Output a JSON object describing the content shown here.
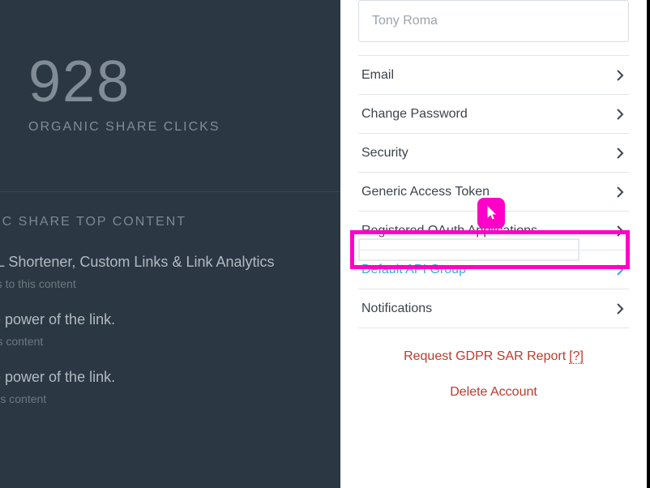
{
  "dark": {
    "stat_number": "928",
    "stat_label": "ORGANIC SHARE CLICKS",
    "section_title": "ANIC SHARE TOP CONTENT",
    "items": [
      {
        "title": "URL Shortener, Custom Links & Link Analytics",
        "sub": "Links to this content"
      },
      {
        "title": "The power of the link.",
        "sub": "o this content"
      },
      {
        "title": "The power of the link.",
        "sub": " to this content"
      }
    ]
  },
  "sidebar": {
    "name": "Tony Roma",
    "rows": [
      {
        "label": "Email"
      },
      {
        "label": "Change Password"
      },
      {
        "label": "Security"
      },
      {
        "label": "Generic Access Token"
      },
      {
        "label": "Registered OAuth Applications"
      },
      {
        "label": "Default API Group"
      },
      {
        "label": "Notifications"
      }
    ],
    "gdpr": "Request GDPR SAR Report",
    "gdpr_q": "[?]",
    "delete": "Delete Account"
  }
}
